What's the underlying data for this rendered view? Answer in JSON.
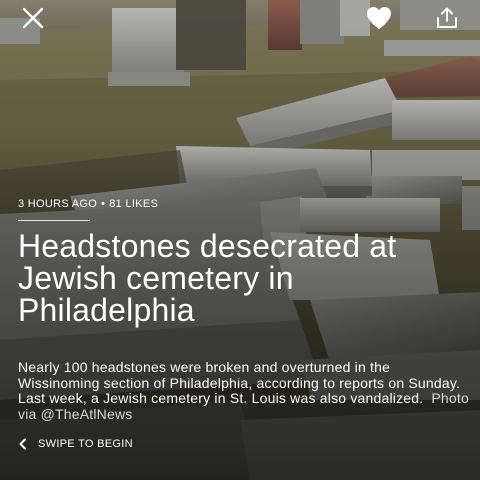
{
  "story": {
    "meta": {
      "time_ago": "3 HOURS AGO",
      "separator": "•",
      "likes": "81 LIKES"
    },
    "headline": "Headstones desecrated at Jewish cemetery in Philadelphia",
    "summary": "Nearly 100 headstones were broken and overturned in the Wissinoming section of Philadelphia, according to reports on Sunday. Last week, a Jewish cemetery in St. Louis was also vandalized.",
    "credit": "Photo via @TheAtlNews",
    "swipe_label": "SWIPE TO BEGIN"
  },
  "icons": {
    "close": "close-icon",
    "like": "heart-icon",
    "share": "share-icon",
    "swipe": "chevron-left-icon"
  },
  "colors": {
    "text": "#ffffff",
    "credit": "#d8d8d8"
  }
}
